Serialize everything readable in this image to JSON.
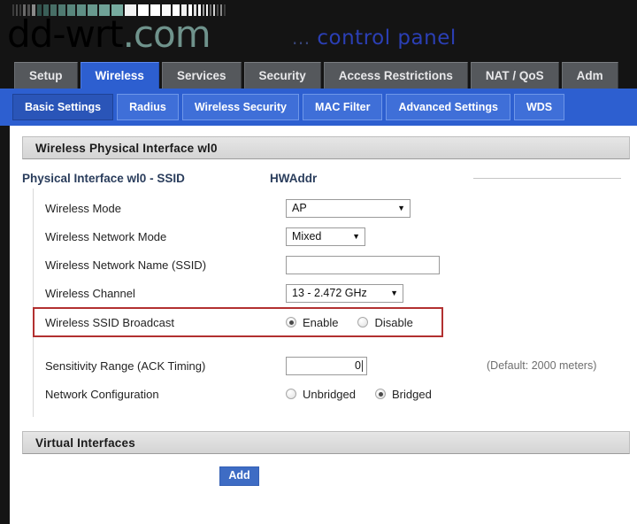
{
  "brand": {
    "logo_main": "dd-wrt",
    "logo_suffix": ".com",
    "tagline_dots": "...",
    "tagline": "control panel",
    "accent_blue": "#2b3fb5",
    "logo_teal": "#6f938c"
  },
  "main_tabs": [
    {
      "label": "Setup",
      "active": false
    },
    {
      "label": "Wireless",
      "active": true
    },
    {
      "label": "Services",
      "active": false
    },
    {
      "label": "Security",
      "active": false
    },
    {
      "label": "Access Restrictions",
      "active": false
    },
    {
      "label": "NAT / QoS",
      "active": false
    },
    {
      "label": "Adm",
      "active": false
    }
  ],
  "sub_tabs": [
    {
      "label": "Basic Settings",
      "active": true
    },
    {
      "label": "Radius",
      "active": false
    },
    {
      "label": "Wireless Security",
      "active": false
    },
    {
      "label": "MAC Filter",
      "active": false
    },
    {
      "label": "Advanced Settings",
      "active": false
    },
    {
      "label": "WDS",
      "active": false
    }
  ],
  "sections": {
    "physical_interface_title": "Wireless Physical Interface wl0",
    "virtual_interfaces_title": "Virtual Interfaces"
  },
  "column_headers": {
    "ssid": "Physical Interface wl0 - SSID",
    "hwaddr": "HWAddr"
  },
  "form": {
    "wireless_mode": {
      "label": "Wireless Mode",
      "value": "AP"
    },
    "wireless_network_mode": {
      "label": "Wireless Network Mode",
      "value": "Mixed"
    },
    "wireless_network_name": {
      "label": "Wireless Network Name (SSID)",
      "value": ""
    },
    "wireless_channel": {
      "label": "Wireless Channel",
      "value": "13 - 2.472 GHz"
    },
    "ssid_broadcast": {
      "label": "Wireless SSID Broadcast",
      "enable_label": "Enable",
      "disable_label": "Disable",
      "selected": "Enable",
      "highlight_color": "#b23030"
    },
    "sensitivity_range": {
      "label": "Sensitivity Range (ACK Timing)",
      "value": "0",
      "hint": "(Default: 2000 meters)"
    },
    "network_configuration": {
      "label": "Network Configuration",
      "unbridged_label": "Unbridged",
      "bridged_label": "Bridged",
      "selected": "Bridged"
    }
  },
  "buttons": {
    "add": "Add"
  },
  "pixel_bar": [
    {
      "w": 2,
      "c": "#3b3b3b"
    },
    {
      "w": 2,
      "c": "#4a4a4a"
    },
    {
      "w": 2,
      "c": "#3b3b3b"
    },
    {
      "w": 3,
      "c": "#6a6a6a"
    },
    {
      "w": 3,
      "c": "#505050"
    },
    {
      "w": 4,
      "c": "#8a8a8a"
    },
    {
      "w": 5,
      "c": "#2f4f49"
    },
    {
      "w": 6,
      "c": "#3a5f58"
    },
    {
      "w": 7,
      "c": "#476e66"
    },
    {
      "w": 8,
      "c": "#4f7a71"
    },
    {
      "w": 9,
      "c": "#58867c"
    },
    {
      "w": 10,
      "c": "#5f8f85"
    },
    {
      "w": 11,
      "c": "#68998e"
    },
    {
      "w": 12,
      "c": "#6fa297"
    },
    {
      "w": 13,
      "c": "#77aca0"
    },
    {
      "w": 13,
      "c": "#f2f2f2"
    },
    {
      "w": 12,
      "c": "#ffffff"
    },
    {
      "w": 11,
      "c": "#ffffff"
    },
    {
      "w": 10,
      "c": "#fafafa"
    },
    {
      "w": 8,
      "c": "#ffffff"
    },
    {
      "w": 6,
      "c": "#f0f0f0"
    },
    {
      "w": 4,
      "c": "#ffffff"
    },
    {
      "w": 3,
      "c": "#dcdcdc"
    },
    {
      "w": 3,
      "c": "#ffffff"
    },
    {
      "w": 2,
      "c": "#9a9a9a"
    },
    {
      "w": 2,
      "c": "#efefef"
    },
    {
      "w": 2,
      "c": "#6a6a6a"
    },
    {
      "w": 2,
      "c": "#cfcfcf"
    },
    {
      "w": 2,
      "c": "#4a4a4a"
    },
    {
      "w": 2,
      "c": "#8a8a8a"
    },
    {
      "w": 2,
      "c": "#3b3b3b"
    }
  ]
}
